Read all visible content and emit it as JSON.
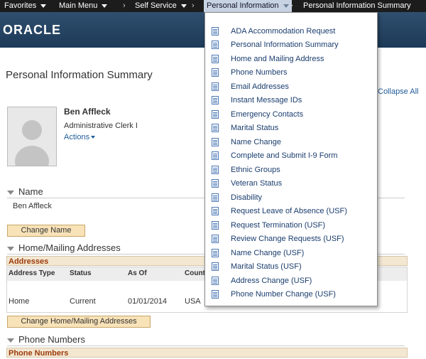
{
  "nav": {
    "favorites": "Favorites",
    "main_menu": "Main Menu",
    "self_service": "Self Service",
    "personal_information": "Personal Information",
    "personal_information_summary": "Personal Information Summary"
  },
  "brand": {
    "logo": "ORACLE"
  },
  "page": {
    "title": "Personal Information Summary",
    "collapse_all": "Collapse All"
  },
  "employee": {
    "name": "Ben Affleck",
    "title": "Administrative Clerk I",
    "actions": "Actions"
  },
  "sections": {
    "name": {
      "header": "Name",
      "value": "Ben Affleck",
      "button": "Change Name"
    },
    "addresses": {
      "header": "Home/Mailing Addresses",
      "grid_title": "Addresses",
      "columns": [
        "Address Type",
        "Status",
        "As Of",
        "Country"
      ],
      "rows": [
        {
          "type": "Home",
          "status": "Current",
          "as_of": "01/01/2014",
          "country": "USA"
        }
      ],
      "button": "Change Home/Mailing Addresses"
    },
    "phones": {
      "header": "Phone Numbers",
      "grid_title": "Phone Numbers"
    }
  },
  "menu": {
    "items": [
      "ADA Accommodation Request",
      "Personal Information Summary",
      "Home and Mailing Address",
      "Phone Numbers",
      "Email Addresses",
      "Instant Message IDs",
      "Emergency Contacts",
      "Marital Status",
      "Name Change",
      "Complete and Submit I-9 Form",
      "Ethnic Groups",
      "Veteran Status",
      "Disability",
      "Request Leave of Absence (USF)",
      "Request Termination (USF)",
      "Review Change Requests (USF)",
      "Name Change (USF)",
      "Marital Status (USF)",
      "Address Change (USF)",
      "Phone Number Change (USF)"
    ]
  },
  "colors": {
    "nav_bg": "#1c1c1c",
    "banner_bg": "#2f4f6e",
    "link": "#1f5c99",
    "button_bg": "#f8e2b8",
    "grid_title": "#9b3a0a"
  }
}
